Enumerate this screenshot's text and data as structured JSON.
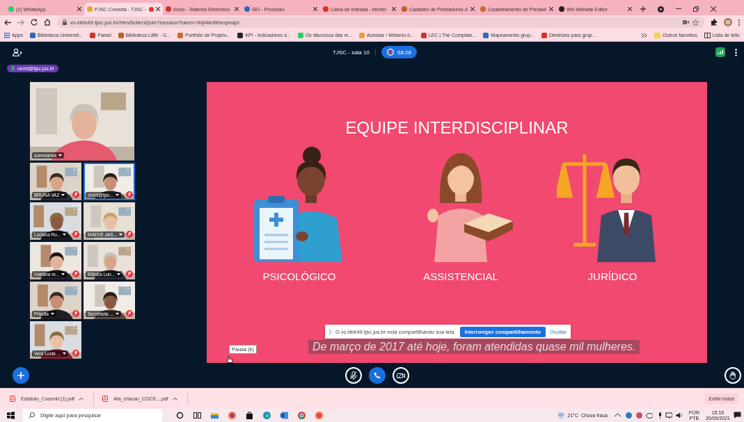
{
  "browser": {
    "tabs": [
      {
        "title": "(2) WhatsApp",
        "selected": false,
        "recording": false
      },
      {
        "title": "PJSC Conecta - TJSC -",
        "selected": true,
        "recording": true
      },
      {
        "title": "Início - Sistema Eletrônico",
        "selected": false,
        "recording": false
      },
      {
        "title": "SEI - Processo",
        "selected": false,
        "recording": false
      },
      {
        "title": "Caixa de entrada - michel",
        "selected": false,
        "recording": false
      },
      {
        "title": "Cadastro de Prestadores d",
        "selected": false,
        "recording": false
      },
      {
        "title": "Cadastramento de Prestad",
        "selected": false,
        "recording": false
      },
      {
        "title": "Wix Website Editor",
        "selected": false,
        "recording": false
      }
    ],
    "address": "vc-bbb49.tjsc.jus.br/html5client/join?sessionToken=9dj4ikr6theqmajd",
    "bookmarks": [
      "Apps",
      "Biblioteca Universit...",
      "Painel",
      "Biblioteca Lilith - G...",
      "Portfólio de Projeto...",
      "KPI - Indicadores d...",
      "Os discursos das m...",
      "Acessar ‹ Misterio d...",
      "LEC | The Complian...",
      "Mapeamento grup...",
      "Diretrizes para grup..."
    ],
    "other_bookmarks": "Outros favoritos",
    "reading_list": "Lista de leitu"
  },
  "meeting": {
    "room": "TJSC - sala 10",
    "recording_time": "58:28",
    "presenter": "cevid@tjsc.jus.br",
    "participants": [
      {
        "name": "sommariva",
        "selected": false,
        "muted": false
      },
      {
        "name": "BRUNA VAZ",
        "selected": false,
        "muted": true
      },
      {
        "name": "cevid@tjsc...",
        "selected": true,
        "muted": true
      },
      {
        "name": "Luciana Ro...",
        "selected": false,
        "muted": true
      },
      {
        "name": "MAEVE JAS...",
        "selected": false,
        "muted": true
      },
      {
        "name": "mariana m...",
        "selected": false,
        "muted": true
      },
      {
        "name": "Mônica Lun...",
        "selected": false,
        "muted": true
      },
      {
        "name": "Priscila",
        "selected": false,
        "muted": true
      },
      {
        "name": "Secretaria ...",
        "selected": false,
        "muted": true
      },
      {
        "name": "Vera Lucia ...",
        "selected": false,
        "muted": true
      }
    ],
    "slide": {
      "title": "EQUIPE INTERDISCIPLINAR",
      "roles": [
        {
          "label": "PSICOLÓGICO",
          "kind": "psychologist"
        },
        {
          "label": "ASSISTENCIAL",
          "kind": "social-worker"
        },
        {
          "label": "JURÍDICO",
          "kind": "lawyer"
        }
      ],
      "caption": "De março de 2017 até hoje, foram atendidas quase mil mulheres."
    },
    "share_notice": {
      "text": "O vc-bbb49.tjsc.jus.br está compartilhando sua tela.",
      "stop_button": "Interromper compartilhamento",
      "hide_link": "Ocultar"
    },
    "tooltip": "Pausa (k)"
  },
  "downloads": {
    "files": [
      "Estatuto_Cocevid (1).pdf",
      "Ata_criacao_COCE....pdf"
    ],
    "show_all": "Exibir todos"
  },
  "taskbar": {
    "search_placeholder": "Digite aqui para pesquisar",
    "weather": "21°C  Chuva fraca",
    "language": "POR",
    "layout": "PTB",
    "time": "15:15",
    "date": "20/09/2021"
  }
}
